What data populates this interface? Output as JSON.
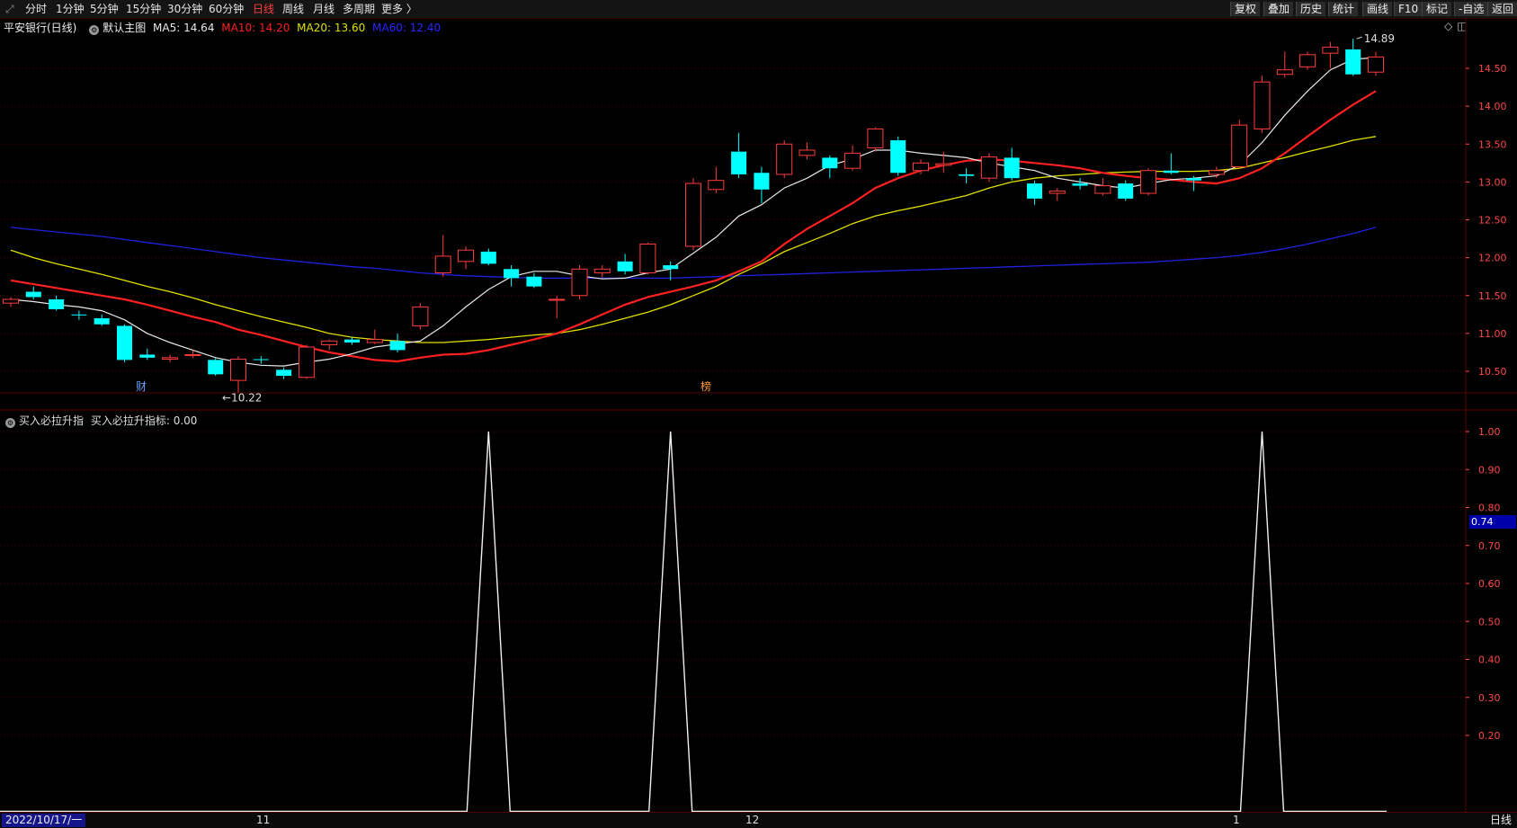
{
  "toolbar": {
    "left_items": [
      "分时",
      "1分钟",
      "5分钟",
      "15分钟",
      "30分钟",
      "60分钟",
      "日线",
      "周线",
      "月线",
      "多周期",
      "更多 〉"
    ],
    "active_index": 6,
    "right_items": [
      "复权",
      "叠加",
      "历史",
      "统计",
      "画线",
      "F10",
      "标记",
      "-自选",
      "返回"
    ]
  },
  "legend": {
    "stock": "平安银行(日线)",
    "template": "默认主图",
    "ma5": "MA5: 14.64",
    "ma10": "MA10: 14.20",
    "ma20": "MA20: 13.60",
    "ma60": "MA60: 12.40"
  },
  "colors": {
    "ma5": "#e8e8e8",
    "ma10": "#ff2020",
    "ma20": "#e0e000",
    "ma60": "#2020e0",
    "up": "#ff3c3c",
    "down": "#00ffff",
    "grid": "#5a0000",
    "axis": "#ff4848"
  },
  "price_axis": [
    "14.50",
    "14.00",
    "13.50",
    "13.00",
    "12.50",
    "12.00",
    "11.50",
    "11.00",
    "10.50"
  ],
  "annotations": {
    "high": "14.89",
    "low": "10.22",
    "fin": "财",
    "rank": "榜"
  },
  "indicator": {
    "name": "买入必拉升指",
    "label": "买入必拉升指标: 0.00",
    "axis": [
      "1.00",
      "0.90",
      "0.80",
      "0.70",
      "0.60",
      "0.50",
      "0.40",
      "0.30",
      "0.20"
    ],
    "highlight": "0.74"
  },
  "dates": {
    "start": "2022/10/17/一",
    "ticks": [
      "11",
      "12",
      "1"
    ],
    "period": "日线"
  },
  "chart_data": {
    "type": "candlestick",
    "candles": [
      {
        "o": 11.4,
        "h": 11.48,
        "l": 11.35,
        "c": 11.45
      },
      {
        "o": 11.55,
        "h": 11.62,
        "l": 11.45,
        "c": 11.48
      },
      {
        "o": 11.45,
        "h": 11.5,
        "l": 11.3,
        "c": 11.32
      },
      {
        "o": 11.25,
        "h": 11.3,
        "l": 11.18,
        "c": 11.24
      },
      {
        "o": 11.2,
        "h": 11.25,
        "l": 11.1,
        "c": 11.12
      },
      {
        "o": 11.1,
        "h": 11.12,
        "l": 10.62,
        "c": 10.65
      },
      {
        "o": 10.72,
        "h": 10.8,
        "l": 10.65,
        "c": 10.68
      },
      {
        "o": 10.66,
        "h": 10.72,
        "l": 10.62,
        "c": 10.68
      },
      {
        "o": 10.72,
        "h": 10.78,
        "l": 10.68,
        "c": 10.72
      },
      {
        "o": 10.65,
        "h": 10.68,
        "l": 10.44,
        "c": 10.46
      },
      {
        "o": 10.38,
        "h": 10.7,
        "l": 10.22,
        "c": 10.66
      },
      {
        "o": 10.66,
        "h": 10.7,
        "l": 10.6,
        "c": 10.65
      },
      {
        "o": 10.52,
        "h": 10.55,
        "l": 10.4,
        "c": 10.44
      },
      {
        "o": 10.42,
        "h": 10.85,
        "l": 10.4,
        "c": 10.82
      },
      {
        "o": 10.85,
        "h": 10.92,
        "l": 10.78,
        "c": 10.9
      },
      {
        "o": 10.92,
        "h": 10.95,
        "l": 10.85,
        "c": 10.88
      },
      {
        "o": 10.88,
        "h": 11.05,
        "l": 10.86,
        "c": 10.92
      },
      {
        "o": 10.9,
        "h": 11.0,
        "l": 10.75,
        "c": 10.78
      },
      {
        "o": 11.1,
        "h": 11.4,
        "l": 11.05,
        "c": 11.35
      },
      {
        "o": 11.8,
        "h": 12.3,
        "l": 11.75,
        "c": 12.02
      },
      {
        "o": 11.95,
        "h": 12.15,
        "l": 11.85,
        "c": 12.1
      },
      {
        "o": 12.08,
        "h": 12.12,
        "l": 11.9,
        "c": 11.92
      },
      {
        "o": 11.85,
        "h": 11.9,
        "l": 11.62,
        "c": 11.73
      },
      {
        "o": 11.75,
        "h": 11.8,
        "l": 11.6,
        "c": 11.62
      },
      {
        "o": 11.45,
        "h": 11.5,
        "l": 11.2,
        "c": 11.45
      },
      {
        "o": 11.5,
        "h": 11.9,
        "l": 11.45,
        "c": 11.85
      },
      {
        "o": 11.8,
        "h": 11.9,
        "l": 11.74,
        "c": 11.85
      },
      {
        "o": 11.95,
        "h": 12.05,
        "l": 11.78,
        "c": 11.82
      },
      {
        "o": 11.8,
        "h": 12.2,
        "l": 11.78,
        "c": 12.18
      },
      {
        "o": 11.9,
        "h": 11.95,
        "l": 11.7,
        "c": 11.85
      },
      {
        "o": 12.15,
        "h": 13.05,
        "l": 12.1,
        "c": 12.98
      },
      {
        "o": 12.9,
        "h": 13.2,
        "l": 12.85,
        "c": 13.02
      },
      {
        "o": 13.4,
        "h": 13.65,
        "l": 13.05,
        "c": 13.1
      },
      {
        "o": 13.12,
        "h": 13.2,
        "l": 12.72,
        "c": 12.9
      },
      {
        "o": 13.1,
        "h": 13.55,
        "l": 13.05,
        "c": 13.5
      },
      {
        "o": 13.35,
        "h": 13.52,
        "l": 13.3,
        "c": 13.42
      },
      {
        "o": 13.32,
        "h": 13.35,
        "l": 13.05,
        "c": 13.18
      },
      {
        "o": 13.18,
        "h": 13.48,
        "l": 13.15,
        "c": 13.38
      },
      {
        "o": 13.45,
        "h": 13.72,
        "l": 13.4,
        "c": 13.7
      },
      {
        "o": 13.55,
        "h": 13.6,
        "l": 13.08,
        "c": 13.12
      },
      {
        "o": 13.15,
        "h": 13.3,
        "l": 13.1,
        "c": 13.25
      },
      {
        "o": 13.22,
        "h": 13.4,
        "l": 13.12,
        "c": 13.24
      },
      {
        "o": 13.1,
        "h": 13.18,
        "l": 12.98,
        "c": 13.08
      },
      {
        "o": 13.05,
        "h": 13.38,
        "l": 13.0,
        "c": 13.33
      },
      {
        "o": 13.32,
        "h": 13.45,
        "l": 13.02,
        "c": 13.05
      },
      {
        "o": 12.98,
        "h": 13.02,
        "l": 12.7,
        "c": 12.78
      },
      {
        "o": 12.85,
        "h": 12.92,
        "l": 12.75,
        "c": 12.88
      },
      {
        "o": 12.98,
        "h": 13.05,
        "l": 12.9,
        "c": 12.95
      },
      {
        "o": 12.85,
        "h": 13.05,
        "l": 12.82,
        "c": 12.95
      },
      {
        "o": 12.98,
        "h": 13.02,
        "l": 12.75,
        "c": 12.78
      },
      {
        "o": 12.85,
        "h": 13.18,
        "l": 12.82,
        "c": 13.15
      },
      {
        "o": 13.15,
        "h": 13.38,
        "l": 13.1,
        "c": 13.12
      },
      {
        "o": 13.05,
        "h": 13.08,
        "l": 12.88,
        "c": 13.02
      },
      {
        "o": 13.1,
        "h": 13.2,
        "l": 13.05,
        "c": 13.15
      },
      {
        "o": 13.2,
        "h": 13.82,
        "l": 13.18,
        "c": 13.75
      },
      {
        "o": 13.7,
        "h": 14.4,
        "l": 13.65,
        "c": 14.32
      },
      {
        "o": 14.42,
        "h": 14.72,
        "l": 14.38,
        "c": 14.48
      },
      {
        "o": 14.52,
        "h": 14.72,
        "l": 14.48,
        "c": 14.68
      },
      {
        "o": 14.7,
        "h": 14.85,
        "l": 14.5,
        "c": 14.78
      },
      {
        "o": 14.75,
        "h": 14.89,
        "l": 14.4,
        "c": 14.42
      },
      {
        "o": 14.45,
        "h": 14.72,
        "l": 14.4,
        "c": 14.65
      }
    ],
    "ma5": [
      11.45,
      11.42,
      11.38,
      11.35,
      11.3,
      11.18,
      11.0,
      10.88,
      10.78,
      10.68,
      10.62,
      10.58,
      10.57,
      10.62,
      10.66,
      10.73,
      10.82,
      10.86,
      10.9,
      11.1,
      11.35,
      11.58,
      11.75,
      11.82,
      11.82,
      11.76,
      11.72,
      11.73,
      11.8,
      11.85,
      12.06,
      12.27,
      12.55,
      12.7,
      12.92,
      13.05,
      13.22,
      13.3,
      13.42,
      13.42,
      13.38,
      13.35,
      13.32,
      13.25,
      13.2,
      13.15,
      13.05,
      13.0,
      12.95,
      12.92,
      12.98,
      13.03,
      13.05,
      13.08,
      13.22,
      13.52,
      13.88,
      14.2,
      14.48,
      14.62,
      14.64
    ],
    "ma10": [
      11.7,
      11.65,
      11.6,
      11.55,
      11.5,
      11.45,
      11.38,
      11.3,
      11.22,
      11.15,
      11.05,
      10.98,
      10.9,
      10.82,
      10.75,
      10.7,
      10.65,
      10.63,
      10.68,
      10.72,
      10.73,
      10.78,
      10.85,
      10.92,
      11.0,
      11.12,
      11.25,
      11.38,
      11.48,
      11.55,
      11.62,
      11.7,
      11.82,
      11.95,
      12.18,
      12.38,
      12.55,
      12.72,
      12.92,
      13.05,
      13.15,
      13.22,
      13.28,
      13.3,
      13.28,
      13.25,
      13.22,
      13.18,
      13.12,
      13.08,
      13.05,
      13.03,
      13.0,
      12.98,
      13.05,
      13.18,
      13.38,
      13.6,
      13.82,
      14.02,
      14.2
    ],
    "ma20": [
      12.1,
      12.0,
      11.92,
      11.85,
      11.78,
      11.7,
      11.62,
      11.55,
      11.47,
      11.38,
      11.3,
      11.22,
      11.15,
      11.08,
      11.0,
      10.95,
      10.92,
      10.9,
      10.88,
      10.88,
      10.9,
      10.92,
      10.95,
      10.98,
      11.0,
      11.05,
      11.12,
      11.2,
      11.28,
      11.38,
      11.5,
      11.62,
      11.78,
      11.92,
      12.08,
      12.2,
      12.32,
      12.45,
      12.55,
      12.62,
      12.68,
      12.75,
      12.82,
      12.92,
      13.0,
      13.05,
      13.08,
      13.1,
      13.12,
      13.13,
      13.14,
      13.14,
      13.14,
      13.15,
      13.18,
      13.25,
      13.32,
      13.4,
      13.47,
      13.55,
      13.6
    ],
    "ma60": [
      12.4,
      12.37,
      12.34,
      12.31,
      12.28,
      12.24,
      12.2,
      12.16,
      12.12,
      12.08,
      12.04,
      12.0,
      11.97,
      11.94,
      11.91,
      11.88,
      11.86,
      11.83,
      11.8,
      11.78,
      11.76,
      11.75,
      11.74,
      11.73,
      11.73,
      11.73,
      11.73,
      11.73,
      11.73,
      11.73,
      11.74,
      11.75,
      11.76,
      11.77,
      11.78,
      11.79,
      11.8,
      11.81,
      11.82,
      11.83,
      11.84,
      11.85,
      11.86,
      11.87,
      11.88,
      11.89,
      11.9,
      11.91,
      11.92,
      11.93,
      11.94,
      11.96,
      11.98,
      12.0,
      12.03,
      12.07,
      12.12,
      12.18,
      12.25,
      12.32,
      12.4
    ],
    "indicator_spikes": [
      21,
      29,
      55
    ]
  }
}
